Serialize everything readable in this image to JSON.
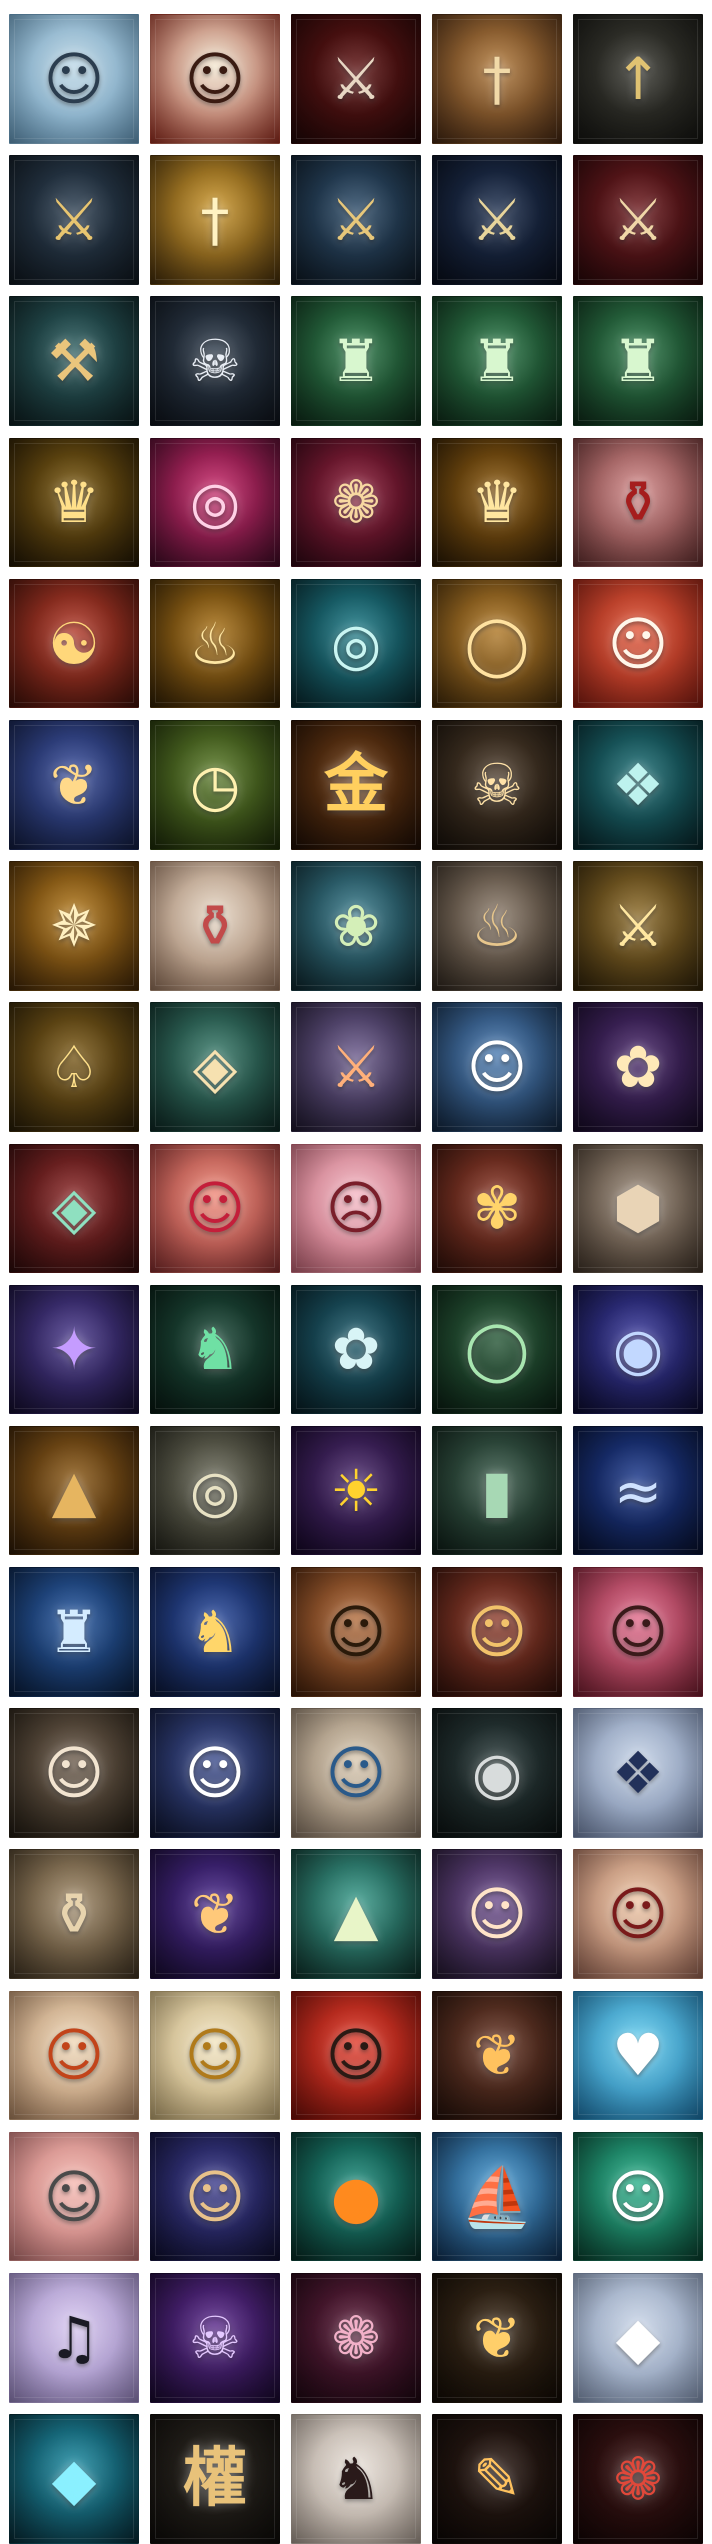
{
  "icon_grid": {
    "columns": 5,
    "tiles": [
      {
        "name": "portrait-swordsman-icon",
        "glyph": "☺",
        "bg": [
          "#bcd7e6",
          "#5f8fb0"
        ],
        "fg": "#2b3d4f"
      },
      {
        "name": "bamboo-hat-warrior-icon",
        "glyph": "☺",
        "bg": [
          "#f3e6d0",
          "#8d2b1e"
        ],
        "fg": "#3a1b12"
      },
      {
        "name": "crossed-swords-crimson-icon",
        "glyph": "⚔",
        "bg": [
          "#5c1414",
          "#1e0606"
        ],
        "fg": "#e8d7c4"
      },
      {
        "name": "bronze-sword-icon",
        "glyph": "†",
        "bg": [
          "#b07a3e",
          "#3f2411"
        ],
        "fg": "#f1d9a8"
      },
      {
        "name": "golden-spear-icon",
        "glyph": "↑",
        "bg": [
          "#3a3a33",
          "#12120f"
        ],
        "fg": "#e0c272"
      },
      {
        "name": "curved-saber-night-icon",
        "glyph": "⚔",
        "bg": [
          "#2b3d4f",
          "#0e151c"
        ],
        "fg": "#e8c570"
      },
      {
        "name": "golden-blade-icon",
        "glyph": "†",
        "bg": [
          "#c9962e",
          "#3f2a0a"
        ],
        "fg": "#fff2c2"
      },
      {
        "name": "glaive-blue-icon",
        "glyph": "⚔",
        "bg": [
          "#2c4a66",
          "#0c1620"
        ],
        "fg": "#e7c77a"
      },
      {
        "name": "halberd-starry-icon",
        "glyph": "⚔",
        "bg": [
          "#1e2f4d",
          "#070c18"
        ],
        "fg": "#e8d59b"
      },
      {
        "name": "crimson-sword-icon",
        "glyph": "⚔",
        "bg": [
          "#6b1b1f",
          "#220608"
        ],
        "fg": "#f0d7a8"
      },
      {
        "name": "war-hammer-icon",
        "glyph": "⚒",
        "bg": [
          "#2a5a5c",
          "#0c1b1d"
        ],
        "fg": "#eac57c"
      },
      {
        "name": "dragon-mask-silver-icon",
        "glyph": "☠",
        "bg": [
          "#2e3b4a",
          "#0c1118"
        ],
        "fg": "#e9eef5"
      },
      {
        "name": "jade-emblem-green-icon",
        "glyph": "♜",
        "bg": [
          "#2f7a4b",
          "#0c2616"
        ],
        "fg": "#d8f7cf"
      },
      {
        "name": "jade-emblem-green-2-icon",
        "glyph": "♜",
        "bg": [
          "#2f7a4b",
          "#0c2616"
        ],
        "fg": "#d8f7cf"
      },
      {
        "name": "jade-emblem-green-3-icon",
        "glyph": "♜",
        "bg": [
          "#2f7a4b",
          "#0c2616"
        ],
        "fg": "#d8f7cf"
      },
      {
        "name": "golden-beast-mask-icon",
        "glyph": "♛",
        "bg": [
          "#7a5a14",
          "#1e1404"
        ],
        "fg": "#ffe08a"
      },
      {
        "name": "pink-vortex-icon",
        "glyph": "◎",
        "bg": [
          "#c62a6a",
          "#3a0a22"
        ],
        "fg": "#ffd1e6"
      },
      {
        "name": "crimson-lotus-crest-icon",
        "glyph": "❁",
        "bg": [
          "#8a1f3a",
          "#2a0612"
        ],
        "fg": "#f7d8a1"
      },
      {
        "name": "golden-crown-altar-icon",
        "glyph": "♛",
        "bg": [
          "#8a5a12",
          "#241604"
        ],
        "fg": "#ffe6a0"
      },
      {
        "name": "red-vase-icon",
        "glyph": "⚱",
        "bg": [
          "#d28a8a",
          "#5a2a2a"
        ],
        "fg": "#a51d1d"
      },
      {
        "name": "compass-taichi-icon",
        "glyph": "☯",
        "bg": [
          "#b03a2a",
          "#3a0f08"
        ],
        "fg": "#ffd77a"
      },
      {
        "name": "flame-lotus-icon",
        "glyph": "♨",
        "bg": [
          "#a8721a",
          "#2c1c04"
        ],
        "fg": "#ffe7a3"
      },
      {
        "name": "teal-dragon-ring-icon",
        "glyph": "◎",
        "bg": [
          "#1f7a86",
          "#072328"
        ],
        "fg": "#c9f5f2"
      },
      {
        "name": "golden-halo-ring-icon",
        "glyph": "◯",
        "bg": [
          "#b07a2a",
          "#3a2508"
        ],
        "fg": "#ffe2a0"
      },
      {
        "name": "lucky-cat-icon",
        "glyph": "☺",
        "bg": [
          "#e0573a",
          "#7a1a10"
        ],
        "fg": "#fff6ea"
      },
      {
        "name": "butterfly-charm-icon",
        "glyph": "❦",
        "bg": [
          "#3b4f9a",
          "#111a3a"
        ],
        "fg": "#ffd98a"
      },
      {
        "name": "jade-clock-disc-icon",
        "glyph": "◷",
        "bg": [
          "#5a7a2a",
          "#1a2608"
        ],
        "fg": "#fff1b0"
      },
      {
        "name": "golden-character-emblem-icon",
        "glyph": "金",
        "cjk": true,
        "bg": [
          "#6a3a14",
          "#1a0c04"
        ],
        "fg": "#ffcf5e"
      },
      {
        "name": "demon-mask-golden-icon",
        "glyph": "☠",
        "bg": [
          "#4a3a2a",
          "#140e08"
        ],
        "fg": "#ffe2a8"
      },
      {
        "name": "jade-knot-teal-icon",
        "glyph": "❖",
        "bg": [
          "#1f6e74",
          "#062024"
        ],
        "fg": "#bdf2ee"
      },
      {
        "name": "golden-compass-disc-icon",
        "glyph": "✵",
        "bg": [
          "#b0781e",
          "#3a2206"
        ],
        "fg": "#fff0c0"
      },
      {
        "name": "porcelain-vase-icon",
        "glyph": "⚱",
        "bg": [
          "#e6d6c4",
          "#8a6a54"
        ],
        "fg": "#c24a4a"
      },
      {
        "name": "lotus-seedpod-icon",
        "glyph": "❀",
        "bg": [
          "#3a7a8a",
          "#0c2228"
        ],
        "fg": "#d4efb8"
      },
      {
        "name": "bronze-censer-icon",
        "glyph": "♨",
        "bg": [
          "#8a7a6a",
          "#2a221a"
        ],
        "fg": "#e7c68c"
      },
      {
        "name": "crossed-blades-medallion-icon",
        "glyph": "⚔",
        "bg": [
          "#8a6a2a",
          "#2a1e08"
        ],
        "fg": "#ffe7a0"
      },
      {
        "name": "golden-lock-pendant-icon",
        "glyph": "♤",
        "bg": [
          "#7a5a1a",
          "#241a06"
        ],
        "fg": "#ffe08a"
      },
      {
        "name": "jade-jewel-box-icon",
        "glyph": "◈",
        "bg": [
          "#3a7a6a",
          "#0c2420"
        ],
        "fg": "#f6e1b0"
      },
      {
        "name": "coral-dagger-icon",
        "glyph": "⚔",
        "bg": [
          "#6a5a8a",
          "#1c162a"
        ],
        "fg": "#ffb07a"
      },
      {
        "name": "sailor-cat-icon",
        "glyph": "☺",
        "bg": [
          "#4a7ab0",
          "#102238"
        ],
        "fg": "#ffffff"
      },
      {
        "name": "golden-peony-icon",
        "glyph": "✿",
        "bg": [
          "#4a2a6a",
          "#140a22"
        ],
        "fg": "#ffe9b8"
      },
      {
        "name": "jade-plaque-pendant-icon",
        "glyph": "◈",
        "bg": [
          "#8a2a2a",
          "#2a0a0a"
        ],
        "fg": "#8fe0c0"
      },
      {
        "name": "red-mask-blob-icon",
        "glyph": "☺",
        "bg": [
          "#f08a7a",
          "#7a2a2a"
        ],
        "fg": "#c41e3a"
      },
      {
        "name": "pink-crying-blob-icon",
        "glyph": "☹",
        "bg": [
          "#f5b8c4",
          "#b05a6a"
        ],
        "fg": "#7a1e2a"
      },
      {
        "name": "golden-hairpin-icon",
        "glyph": "✾",
        "bg": [
          "#8a3a2a",
          "#2a0e08"
        ],
        "fg": "#ffd46a"
      },
      {
        "name": "bronze-dodecahedron-icon",
        "glyph": "⬢",
        "bg": [
          "#9a8a7a",
          "#3a2e24"
        ],
        "fg": "#e9d4b6"
      },
      {
        "name": "purple-fan-icon",
        "glyph": "✦",
        "bg": [
          "#4a3a8a",
          "#120c2a"
        ],
        "fg": "#c59cff"
      },
      {
        "name": "jade-dragon-green-icon",
        "glyph": "♞",
        "bg": [
          "#1e4a3a",
          "#061610"
        ],
        "fg": "#6fe0a4"
      },
      {
        "name": "teal-hat-flower-icon",
        "glyph": "✿",
        "bg": [
          "#1e5a6a",
          "#061a20"
        ],
        "fg": "#d8f4f6"
      },
      {
        "name": "jade-bracelet-icon",
        "glyph": "◯",
        "bg": [
          "#2a5a3a",
          "#081a10"
        ],
        "fg": "#a8e6b0"
      },
      {
        "name": "cosmic-eye-icon",
        "glyph": "◉",
        "bg": [
          "#3a3a9a",
          "#0a0a2a"
        ],
        "fg": "#c2d8ff"
      },
      {
        "name": "straw-hat-icon",
        "glyph": "▲",
        "bg": [
          "#8a5a1a",
          "#2a1806"
        ],
        "fg": "#e6b560"
      },
      {
        "name": "silver-bangle-icon",
        "glyph": "◎",
        "bg": [
          "#6a6a5a",
          "#1e1e16"
        ],
        "fg": "#e8e2c4"
      },
      {
        "name": "sun-spiral-icon",
        "glyph": "☀",
        "bg": [
          "#4a2a6a",
          "#120622"
        ],
        "fg": "#ffd22e"
      },
      {
        "name": "jade-seal-icon",
        "glyph": "▮",
        "bg": [
          "#3a5a4a",
          "#0c1a14"
        ],
        "fg": "#a7d8b4"
      },
      {
        "name": "blue-dragon-wave-icon",
        "glyph": "≈",
        "bg": [
          "#1e3a8a",
          "#060e28"
        ],
        "fg": "#cfe2ff"
      },
      {
        "name": "azure-crest-icon",
        "glyph": "♜",
        "bg": [
          "#2a5aa0",
          "#081a36"
        ],
        "fg": "#d4ecff"
      },
      {
        "name": "mecha-knight-icon",
        "glyph": "♞",
        "bg": [
          "#2a4a9a",
          "#0a1430"
        ],
        "fg": "#ffd66a"
      },
      {
        "name": "pixel-bearded-hero-icon",
        "glyph": "☺",
        "bg": [
          "#b06a3a",
          "#3a1a08"
        ],
        "fg": "#2a1a0a"
      },
      {
        "name": "pixel-goggles-hero-icon",
        "glyph": "☺",
        "bg": [
          "#8a3a2a",
          "#2a0e08"
        ],
        "fg": "#f2c26a"
      },
      {
        "name": "pixel-girl-icon",
        "glyph": "☺",
        "bg": [
          "#e06a8a",
          "#6a1a2a"
        ],
        "fg": "#3a1a1a"
      },
      {
        "name": "pixel-ninja-icon",
        "glyph": "☺",
        "bg": [
          "#6a5a4a",
          "#1e1810"
        ],
        "fg": "#f2e4d0"
      },
      {
        "name": "pixel-hooded-icon",
        "glyph": "☺",
        "bg": [
          "#3a4a8a",
          "#0c122a"
        ],
        "fg": "#ffffff"
      },
      {
        "name": "blue-hat-lady-icon",
        "glyph": "☺",
        "bg": [
          "#d8c8b0",
          "#7a6a5a"
        ],
        "fg": "#2a5a8a"
      },
      {
        "name": "silver-medallion-icon",
        "glyph": "◉",
        "bg": [
          "#2a3a3a",
          "#0a1010"
        ],
        "fg": "#d8dcdc"
      },
      {
        "name": "navy-emblem-icon",
        "glyph": "❖",
        "bg": [
          "#c4d2e6",
          "#6a7a9a"
        ],
        "fg": "#22315a"
      },
      {
        "name": "bronze-jar-icon",
        "glyph": "⚱",
        "bg": [
          "#a08a6a",
          "#3a2e1e"
        ],
        "fg": "#e8d4ae"
      },
      {
        "name": "violet-phoenix-icon",
        "glyph": "❦",
        "bg": [
          "#4a2a8a",
          "#140a2a"
        ],
        "fg": "#ffc97a"
      },
      {
        "name": "rice-dumpling-icon",
        "glyph": "▲",
        "bg": [
          "#3a9a8a",
          "#0c2a24"
        ],
        "fg": "#e8f5c8"
      },
      {
        "name": "crowned-lady-icon",
        "glyph": "☺",
        "bg": [
          "#6a4a8a",
          "#1e1428"
        ],
        "fg": "#ffe4c8"
      },
      {
        "name": "red-haired-lady-icon",
        "glyph": "☺",
        "bg": [
          "#f0c8a8",
          "#8a5a4a"
        ],
        "fg": "#7a1a1a"
      },
      {
        "name": "monkey-king-icon",
        "glyph": "☺",
        "bg": [
          "#f0d8b8",
          "#a07a5a"
        ],
        "fg": "#c2441a"
      },
      {
        "name": "golden-buddha-icon",
        "glyph": "☺",
        "bg": [
          "#f2e4c0",
          "#b09a6a"
        ],
        "fg": "#b07a1a"
      },
      {
        "name": "young-man-portrait-icon",
        "glyph": "☺",
        "bg": [
          "#e03a2a",
          "#6a0e08"
        ],
        "fg": "#2a1a14"
      },
      {
        "name": "golden-koi-icon",
        "glyph": "❦",
        "bg": [
          "#6a3a2a",
          "#1e0e08"
        ],
        "fg": "#ffc25e"
      },
      {
        "name": "blue-cocktail-icon",
        "glyph": "♥",
        "bg": [
          "#6ad0f0",
          "#1a6a9a"
        ],
        "fg": "#ffffff"
      },
      {
        "name": "grumpy-cat-icon",
        "glyph": "☺",
        "bg": [
          "#f5b8b0",
          "#b06a6a"
        ],
        "fg": "#4a4a4a"
      },
      {
        "name": "veiled-lady-icon",
        "glyph": "☺",
        "bg": [
          "#3a3a8a",
          "#0c0c28"
        ],
        "fg": "#e8c28a"
      },
      {
        "name": "happy-orange-icon",
        "glyph": "●",
        "bg": [
          "#1e8a7a",
          "#062620"
        ],
        "fg": "#ff8a1e"
      },
      {
        "name": "sailing-ship-icon",
        "glyph": "⛵",
        "bg": [
          "#4a9ad0",
          "#0e2a4a"
        ],
        "fg": "#ffffff"
      },
      {
        "name": "headphone-blob-icon",
        "glyph": "☺",
        "bg": [
          "#2ab08a",
          "#083a2a"
        ],
        "fg": "#ffffff"
      },
      {
        "name": "grand-piano-icon",
        "glyph": "♫",
        "bg": [
          "#d8c8f0",
          "#8a7ab0"
        ],
        "fg": "#1a1a24"
      },
      {
        "name": "violet-demon-mask-icon",
        "glyph": "☠",
        "bg": [
          "#5a2a8a",
          "#16082a"
        ],
        "fg": "#e4c8ff"
      },
      {
        "name": "crimson-crest-dark-icon",
        "glyph": "❁",
        "bg": [
          "#5a1e3a",
          "#1a0610"
        ],
        "fg": "#f2b0c8"
      },
      {
        "name": "golden-phoenix-crest-icon",
        "glyph": "❦",
        "bg": [
          "#3a2a1a",
          "#100a04"
        ],
        "fg": "#ffcf6a"
      },
      {
        "name": "silver-crystal-crest-icon",
        "glyph": "◆",
        "bg": [
          "#c8d4e6",
          "#7a8aa6"
        ],
        "fg": "#ffffff"
      },
      {
        "name": "aqua-crystal-crest-icon",
        "glyph": "◆",
        "bg": [
          "#1e8aa0",
          "#062630"
        ],
        "fg": "#8af0ff"
      },
      {
        "name": "golden-calligraphy-icon",
        "glyph": "權",
        "cjk": true,
        "bg": [
          "#2a2620",
          "#0c0a08"
        ],
        "fg": "#e8c27a"
      },
      {
        "name": "ink-warrior-icon",
        "glyph": "♞",
        "bg": [
          "#e8e0d8",
          "#9a8e84"
        ],
        "fg": "#2a1a1a"
      },
      {
        "name": "scroll-brush-icon",
        "glyph": "✎",
        "bg": [
          "#2a1a14",
          "#0a0604"
        ],
        "fg": "#ffc25e"
      },
      {
        "name": "red-flame-crest-icon",
        "glyph": "❁",
        "bg": [
          "#3a1414",
          "#100404"
        ],
        "fg": "#e0483a"
      }
    ]
  }
}
